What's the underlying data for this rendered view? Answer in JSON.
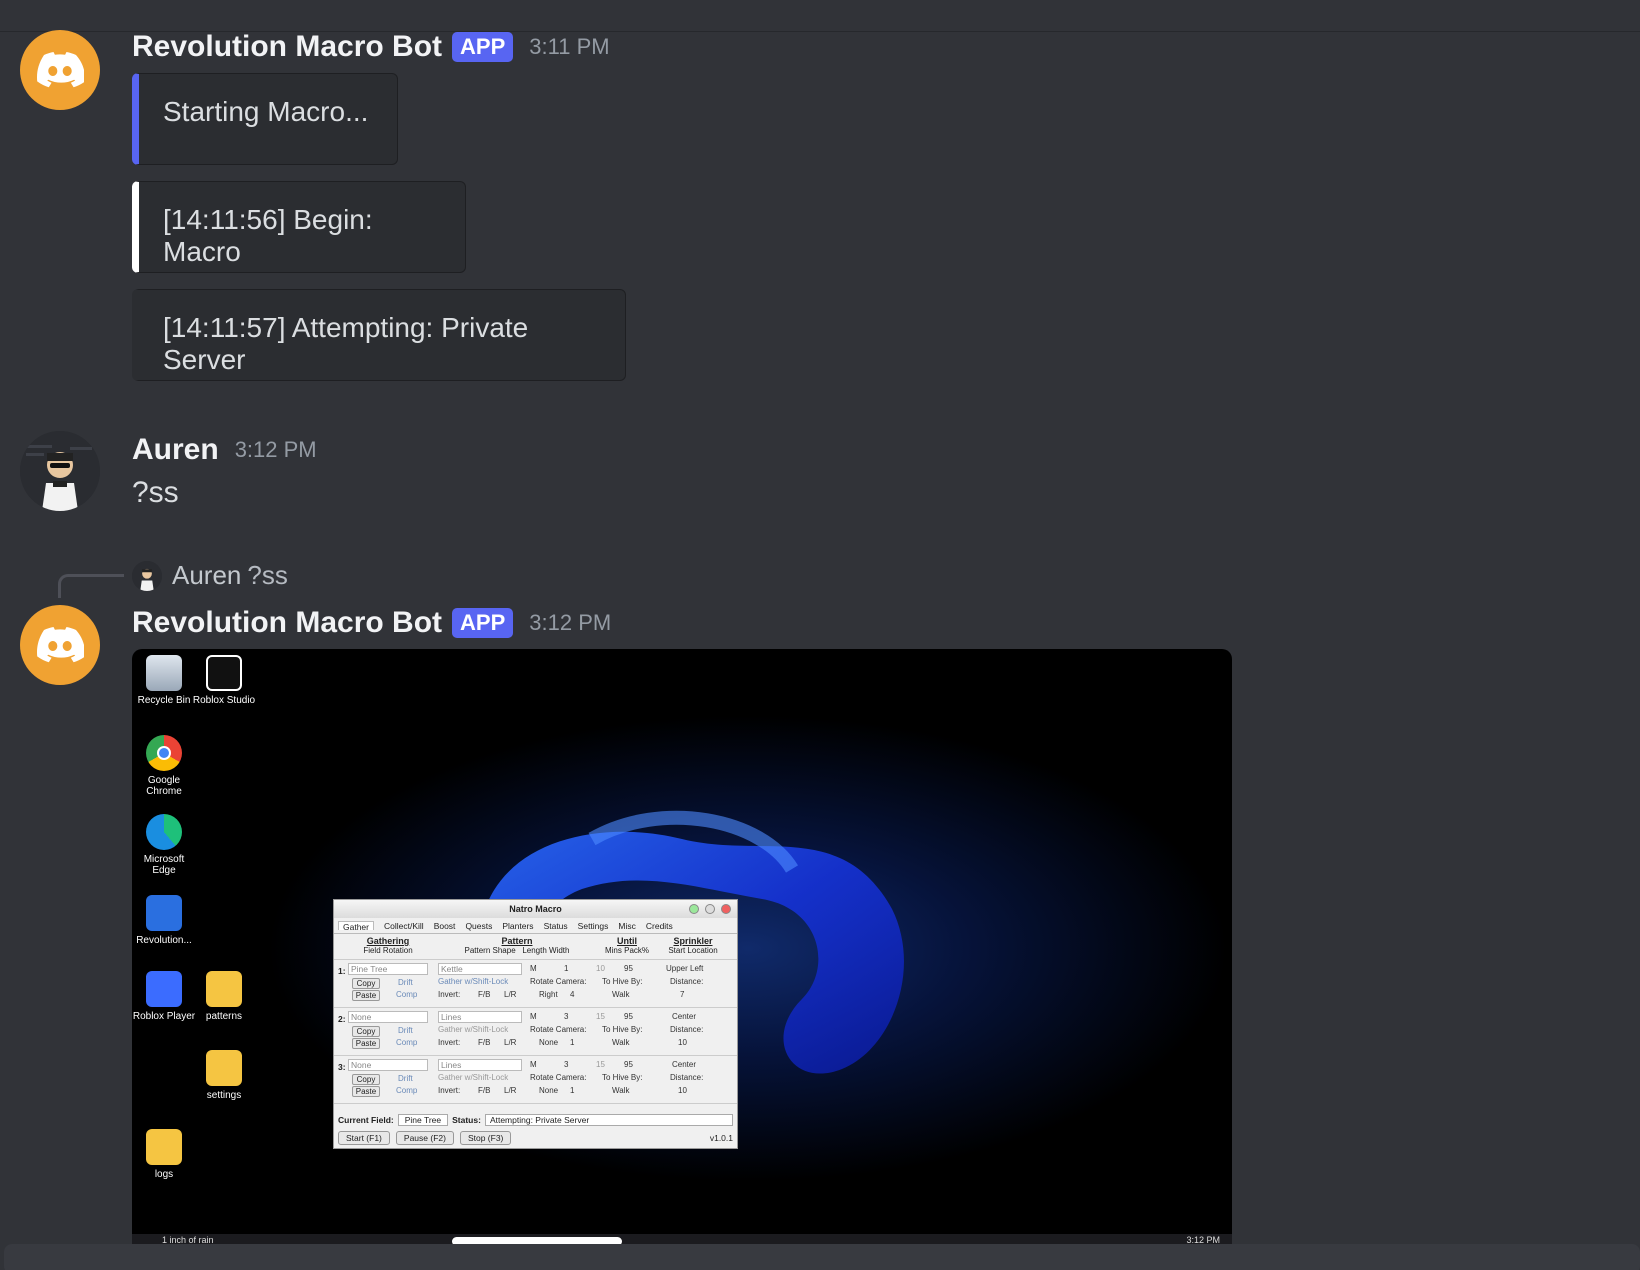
{
  "messages": [
    {
      "author": "Revolution Macro Bot",
      "tag": "APP",
      "time": "3:11 PM",
      "embeds": [
        {
          "text": "Starting Macro...",
          "color": "#5865f2"
        },
        {
          "text": "[14:11:56] Begin: Macro",
          "color": "#ffffff"
        },
        {
          "text": "[14:11:57] Attempting: Private Server",
          "color": "#2b2d31"
        }
      ]
    },
    {
      "author": "Auren",
      "time": "3:12 PM",
      "text": "?ss"
    },
    {
      "reply": {
        "author": "Auren",
        "text": "?ss"
      },
      "author": "Revolution Macro Bot",
      "tag": "APP",
      "time": "3:12 PM"
    }
  ],
  "screenshot": {
    "desktop_icons": {
      "recycle": "Recycle Bin",
      "roblox_studio": "Roblox Studio",
      "chrome": "Google Chrome",
      "edge": "Microsoft Edge",
      "revolution": "Revolution...",
      "roblox_player": "Roblox Player",
      "patterns": "patterns",
      "settings": "settings",
      "logs": "logs"
    },
    "taskbar": {
      "weather": "1 inch of rain",
      "clock": "3:12 PM"
    },
    "natro": {
      "title": "Natro Macro",
      "tabs": [
        "Gather",
        "Collect/Kill",
        "Boost",
        "Quests",
        "Planters",
        "Status",
        "Settings",
        "Misc",
        "Credits"
      ],
      "headers": {
        "gathering": "Gathering",
        "field_rotation": "Field Rotation",
        "pattern": "Pattern",
        "pattern_shape": "Pattern Shape",
        "length": "Length",
        "width": "Width",
        "until": "Until",
        "mins": "Mins",
        "pack": "Pack%",
        "sprinkler": "Sprinkler",
        "start_location": "Start Location"
      },
      "rows": [
        {
          "num": "1:",
          "field": "Pine Tree",
          "pattern": "Kettle",
          "length": "M",
          "width": "1",
          "mins": "10",
          "pack": "95",
          "start": "Upper Left",
          "rotate": "Right",
          "rotate_n": "4",
          "hive_by": "Walk",
          "distance": "7"
        },
        {
          "num": "2:",
          "field": "None",
          "pattern": "Lines",
          "length": "M",
          "width": "3",
          "mins": "15",
          "pack": "95",
          "start": "Center",
          "rotate": "None",
          "rotate_n": "1",
          "hive_by": "Walk",
          "distance": "10"
        },
        {
          "num": "3:",
          "field": "None",
          "pattern": "Lines",
          "length": "M",
          "width": "3",
          "mins": "15",
          "pack": "95",
          "start": "Center",
          "rotate": "None",
          "rotate_n": "1",
          "hive_by": "Walk",
          "distance": "10"
        }
      ],
      "labels": {
        "copy": "Copy",
        "paste": "Paste",
        "drift": "Drift",
        "comp": "Comp",
        "gather_shift": "Gather w/Shift-Lock",
        "invert": "Invert:",
        "fb": "F/B",
        "lr": "L/R",
        "rotate_camera": "Rotate Camera:",
        "to_hive_by": "To Hive By:",
        "distance": "Distance:"
      },
      "current_field_label": "Current Field:",
      "current_field": "Pine Tree",
      "status_label": "Status:",
      "status": "Attempting: Private Server",
      "buttons": {
        "start": "Start (F1)",
        "pause": "Pause (F2)",
        "stop": "Stop (F3)"
      },
      "version": "v1.0.1"
    }
  }
}
